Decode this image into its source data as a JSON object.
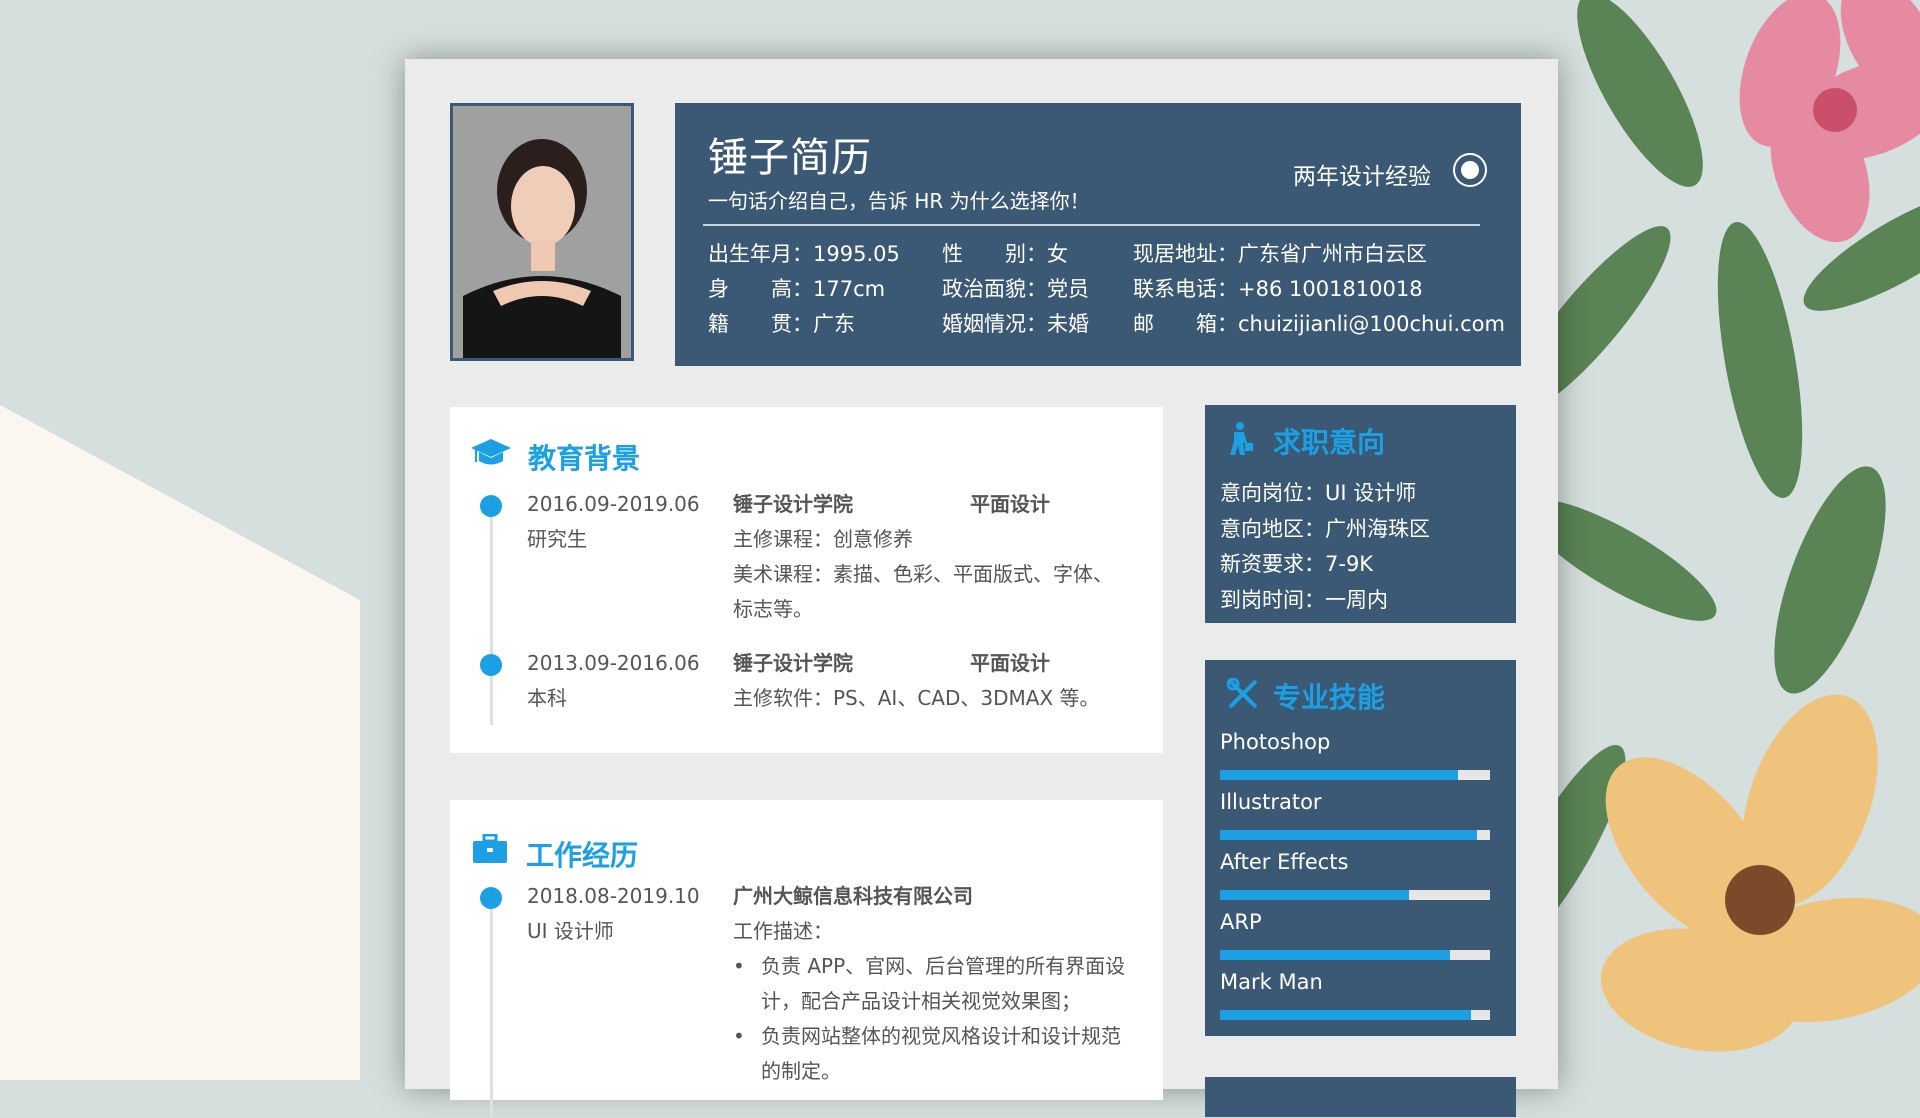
{
  "header": {
    "title": "锤子简历",
    "slogan": "一句话介绍自己，告诉 HR 为什么选择你！",
    "experience": "两年设计经验",
    "info": [
      [
        "出生年月：1995.05",
        "性　　别：女",
        "现居地址：广东省广州市白云区"
      ],
      [
        "身　　高：177cm",
        "政治面貌：党员",
        "联系电话：+86 1001810018"
      ],
      [
        "籍　　贯：广东",
        "婚姻情况：未婚",
        "邮　　箱：chuizijianli@100chui.com"
      ]
    ]
  },
  "education": {
    "title": "教育背景",
    "entries": [
      {
        "date": "2016.09-2019.06",
        "degree": "研究生",
        "school": "锤子设计学院",
        "major": "平面设计",
        "lines": [
          "主修课程：创意修养",
          "美术课程：素描、色彩、平面版式、字体、",
          "标志等。"
        ]
      },
      {
        "date": "2013.09-2016.06",
        "degree": "本科",
        "school": "锤子设计学院",
        "major": "平面设计",
        "lines": [
          "主修软件：PS、AI、CAD、3DMAX 等。"
        ]
      }
    ]
  },
  "work": {
    "title": "工作经历",
    "entries": [
      {
        "date": "2018.08-2019.10",
        "role": "UI 设计师",
        "company": "广州大鲸信息科技有限公司",
        "desc_label": "工作描述：",
        "bullets": [
          [
            "负责 APP、官网、后台管理的所有界面设",
            "计，配合产品设计相关视觉效果图；"
          ],
          [
            "负责网站整体的视觉风格设计和设计规范",
            "的制定。"
          ]
        ]
      }
    ]
  },
  "intent": {
    "title": "求职意向",
    "rows": [
      "意向岗位：UI 设计师",
      "意向地区：广州海珠区",
      "新资要求：7-9K",
      "到岗时间：一周内"
    ]
  },
  "skills": {
    "title": "专业技能",
    "items": [
      {
        "name": "Photoshop",
        "level": 0.88
      },
      {
        "name": "Illustrator",
        "level": 0.95
      },
      {
        "name": "After Effects",
        "level": 0.7
      },
      {
        "name": "ARP",
        "level": 0.85
      },
      {
        "name": "Mark Man",
        "level": 0.93
      }
    ]
  },
  "colors": {
    "primary": "#3b5874",
    "accent": "#1aa0e3"
  }
}
